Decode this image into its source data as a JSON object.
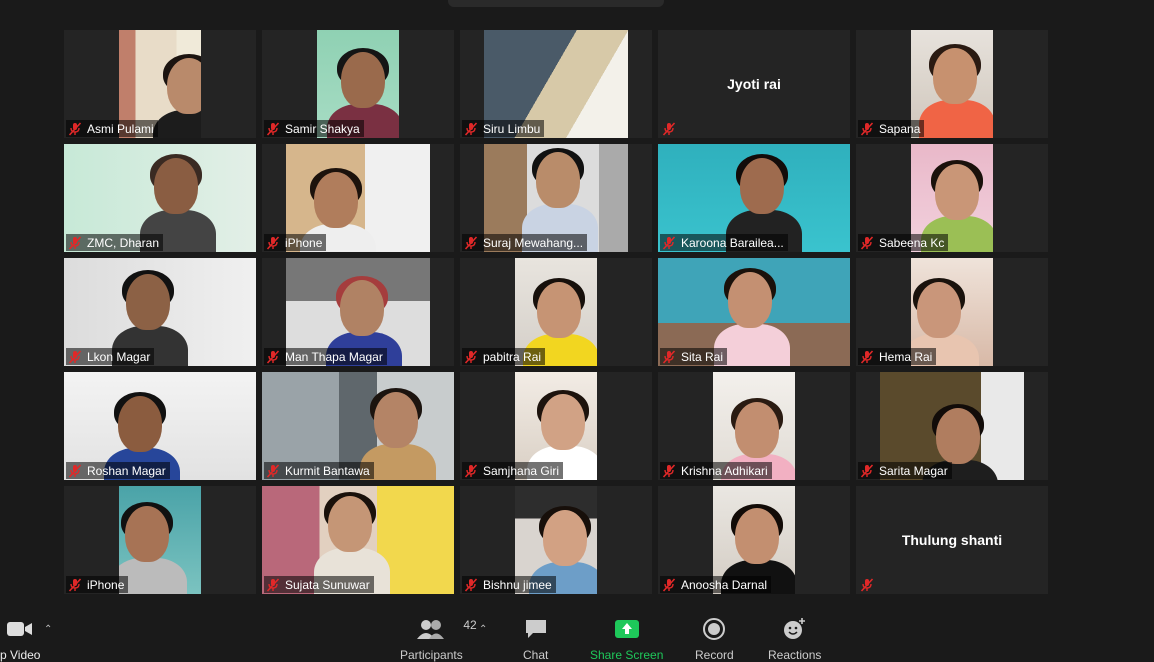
{
  "participants": [
    {
      "name": "Asmi Pulami",
      "video": true
    },
    {
      "name": "Samir Shakya",
      "video": true
    },
    {
      "name": "Siru Limbu",
      "video": true
    },
    {
      "name": "Jyoti rai",
      "video": false
    },
    {
      "name": "Sapana",
      "video": true
    },
    {
      "name": "ZMC, Dharan",
      "video": true
    },
    {
      "name": "iPhone",
      "video": true
    },
    {
      "name": "Suraj Mewahang...",
      "video": true
    },
    {
      "name": "Karoona Barailea...",
      "video": true
    },
    {
      "name": "Sabeena Kc",
      "video": true
    },
    {
      "name": "Lkon Magar",
      "video": true
    },
    {
      "name": "Man Thapa Magar",
      "video": true
    },
    {
      "name": "pabitra Rai",
      "video": true
    },
    {
      "name": "Sita Rai",
      "video": true
    },
    {
      "name": "Hema Rai",
      "video": true
    },
    {
      "name": "Roshan Magar",
      "video": true
    },
    {
      "name": "Kurmit Bantawa",
      "video": true
    },
    {
      "name": "Samjhana Giri",
      "video": true
    },
    {
      "name": "Krishna Adhikari",
      "video": true
    },
    {
      "name": "Sarita Magar",
      "video": true
    },
    {
      "name": "iPhone",
      "video": true
    },
    {
      "name": "Sujata Sunuwar",
      "video": true
    },
    {
      "name": "Bishnu jimee",
      "video": true
    },
    {
      "name": "Anoosha Darnal",
      "video": true
    },
    {
      "name": "Thulung shanti",
      "video": false
    }
  ],
  "toolbar": {
    "video_label": "p Video",
    "participants_label": "Participants",
    "participants_count": "42",
    "chat_label": "Chat",
    "share_label": "Share Screen",
    "record_label": "Record",
    "reactions_label": "Reactions"
  },
  "colors": {
    "background": "#1a1a1a",
    "tile": "#242424",
    "muted_mic": "#e02828",
    "share_green": "#1ec85a"
  }
}
